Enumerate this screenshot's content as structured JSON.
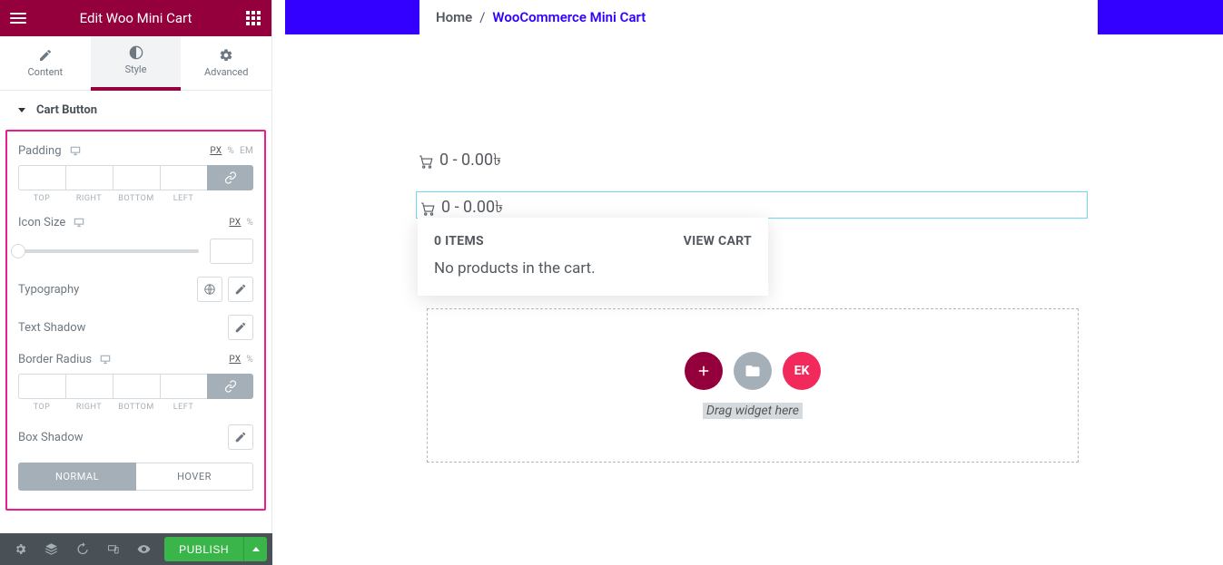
{
  "header": {
    "title": "Edit Woo Mini Cart"
  },
  "tabs": {
    "content": "Content",
    "style": "Style",
    "advanced": "Advanced"
  },
  "section": {
    "title": "Cart Button"
  },
  "controls": {
    "padding": {
      "label": "Padding",
      "units": [
        "PX",
        "%",
        "EM"
      ],
      "active_unit": "PX",
      "caps": [
        "TOP",
        "RIGHT",
        "BOTTOM",
        "LEFT"
      ]
    },
    "icon_size": {
      "label": "Icon Size",
      "units": [
        "PX",
        "%"
      ],
      "active_unit": "PX",
      "value": ""
    },
    "typography": {
      "label": "Typography"
    },
    "text_shadow": {
      "label": "Text Shadow"
    },
    "border_radius": {
      "label": "Border Radius",
      "units": [
        "PX",
        "%"
      ],
      "active_unit": "PX",
      "caps": [
        "TOP",
        "RIGHT",
        "BOTTOM",
        "LEFT"
      ]
    },
    "box_shadow": {
      "label": "Box Shadow"
    },
    "states": {
      "normal": "NORMAL",
      "hover": "HOVER"
    }
  },
  "footer": {
    "publish": "PUBLISH"
  },
  "breadcrumb": {
    "home": "Home",
    "sep": "/",
    "current": "WooCommerce Mini Cart"
  },
  "cart": {
    "display": "0 - 0.00৳",
    "items_label": "0 ITEMS",
    "view": "VIEW CART",
    "empty": "No products in the cart."
  },
  "dropzone": {
    "hint": "Drag widget here",
    "ek": "EK"
  }
}
